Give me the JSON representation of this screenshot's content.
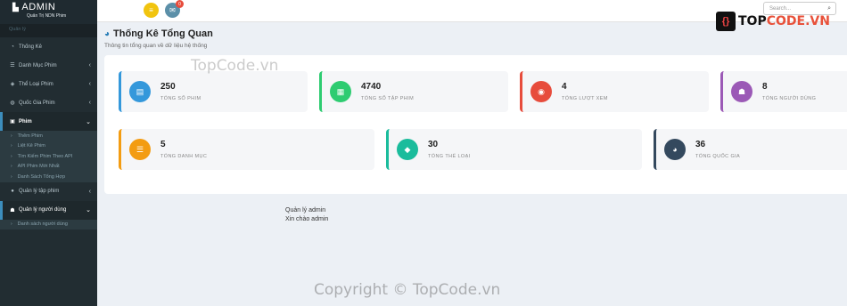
{
  "sidebar": {
    "brand_title": "ADMIN",
    "brand_subtitle": "Quản Trị NDN Phim",
    "section_header": "Quản lý",
    "items": [
      {
        "label": "Thống Kê",
        "icon": "dashboard-icon",
        "arrow": ""
      },
      {
        "label": "Danh Mục Phim",
        "icon": "list-icon",
        "arrow": "‹"
      },
      {
        "label": "Thể Loại Phim",
        "icon": "tags-icon",
        "arrow": "‹"
      },
      {
        "label": "Quốc Gia Phim",
        "icon": "globe-icon",
        "arrow": "‹"
      },
      {
        "label": "Phim",
        "icon": "film-icon",
        "arrow": "⌄"
      }
    ],
    "film_sub": [
      "Thêm Phim",
      "Liệt Kê Phim",
      "Tìm Kiếm Phim Theo API",
      "API Phim Mới Nhất",
      "Danh Sách Tổng Hợp"
    ],
    "episodes": {
      "label": "Quản lý tập phim",
      "arrow": "‹"
    },
    "users": {
      "label": "Quản lý người dùng",
      "arrow": "⌄"
    },
    "users_sub": [
      "Danh sách người dùng"
    ]
  },
  "topbar": {
    "notification_count": "0",
    "search_placeholder": "Search..."
  },
  "logo": {
    "text_left": "TOP",
    "text_right": "CODE.VN"
  },
  "page": {
    "title": "Thống Kê Tổng Quan",
    "subtitle": "Thông tin tổng quan về dữ liệu hệ thống"
  },
  "stats_row1": [
    {
      "value": "250",
      "label": "Tổng số phim",
      "color": "#3498db",
      "icon": "film-icon"
    },
    {
      "value": "4740",
      "label": "Tổng số tập phim",
      "color": "#2ecc71",
      "icon": "episodes-icon"
    },
    {
      "value": "4",
      "label": "Tổng lượt xem",
      "color": "#e74c3c",
      "icon": "eye-icon"
    },
    {
      "value": "8",
      "label": "Tổng người dùng",
      "color": "#9b59b6",
      "icon": "users-icon"
    }
  ],
  "stats_row2": [
    {
      "value": "5",
      "label": "Tổng danh mục",
      "color": "#f39c12",
      "icon": "category-icon"
    },
    {
      "value": "30",
      "label": "Tổng thể loại",
      "color": "#1abc9c",
      "icon": "tag-icon"
    },
    {
      "value": "36",
      "label": "Tổng quốc gia",
      "color": "#34495e",
      "icon": "globe-icon"
    }
  ],
  "footer": {
    "line1": "Quản lý admin",
    "line2": "Xin chào admin"
  },
  "watermarks": {
    "mid": "TopCode.vn",
    "bottom": "Copyright © TopCode.vn"
  }
}
